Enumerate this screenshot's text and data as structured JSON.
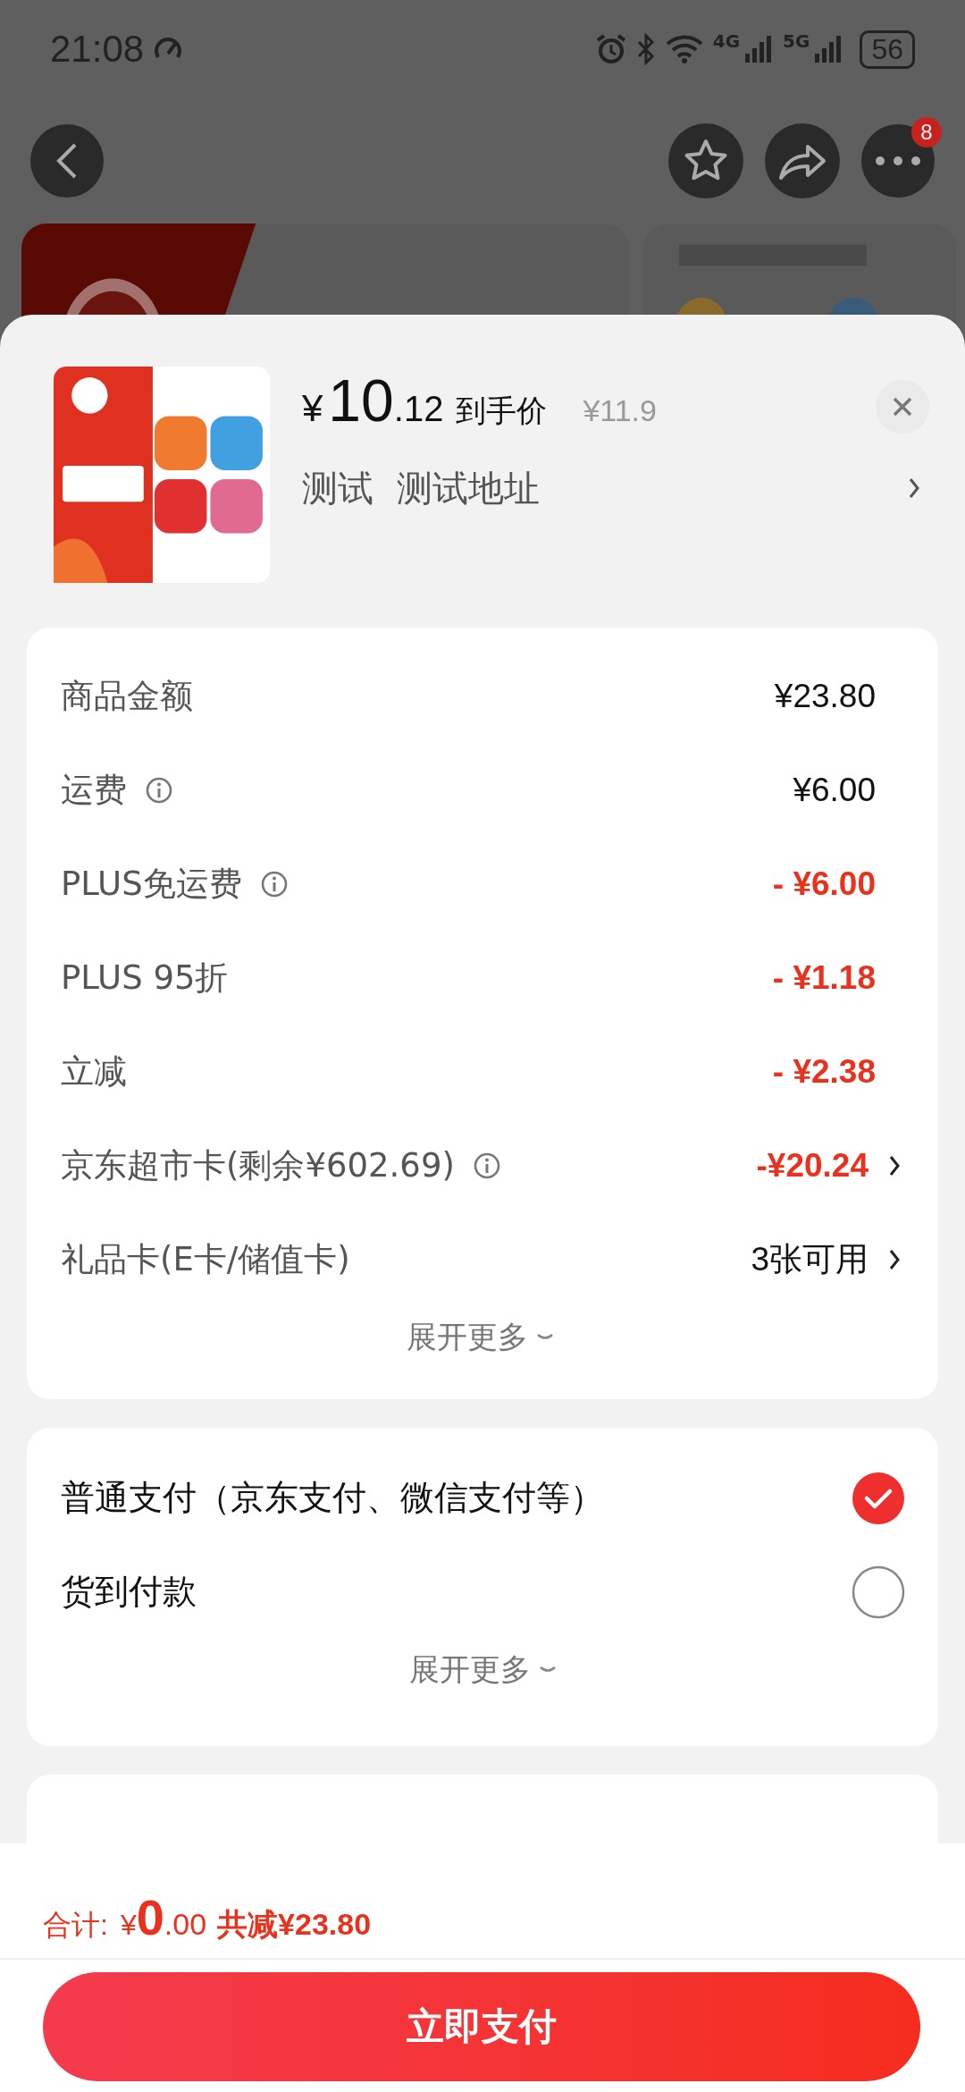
{
  "status_bar": {
    "time": "21:08",
    "network_1": "4G",
    "network_2": "5G",
    "battery": "56"
  },
  "nav": {
    "badge": "8"
  },
  "product": {
    "currency": "¥",
    "price_int": "10",
    "price_dec": ".12",
    "price_label": "到手价",
    "original_price": "¥11.9",
    "name": "测试",
    "address": "测试地址"
  },
  "costs": {
    "rows": [
      {
        "label": "商品金额",
        "info": false,
        "value": "¥23.80",
        "discount": false,
        "arrow": false
      },
      {
        "label": "运费",
        "info": true,
        "value": "¥6.00",
        "discount": false,
        "arrow": false
      },
      {
        "label": "PLUS免运费",
        "info": true,
        "value": "- ¥6.00",
        "discount": true,
        "arrow": false
      },
      {
        "label": "PLUS 95折",
        "info": false,
        "value": "- ¥1.18",
        "discount": true,
        "arrow": false
      },
      {
        "label": "立减",
        "info": false,
        "value": "- ¥2.38",
        "discount": true,
        "arrow": false
      },
      {
        "label": "京东超市卡(剩余¥602.69)",
        "info": true,
        "value": "-¥20.24",
        "discount": true,
        "arrow": true
      },
      {
        "label": "礼品卡(E卡/储值卡)",
        "info": false,
        "value": "3张可用",
        "discount": false,
        "arrow": true
      }
    ],
    "expand": "展开更多"
  },
  "payment": {
    "options": [
      {
        "label": "普通支付（京东支付、微信支付等）",
        "selected": true
      },
      {
        "label": "货到付款",
        "selected": false
      }
    ],
    "expand": "展开更多"
  },
  "total": {
    "label": "合计:",
    "currency": "¥",
    "int": "0",
    "dec": ".00",
    "saved": "共减¥23.80"
  },
  "pay_button": "立即支付"
}
